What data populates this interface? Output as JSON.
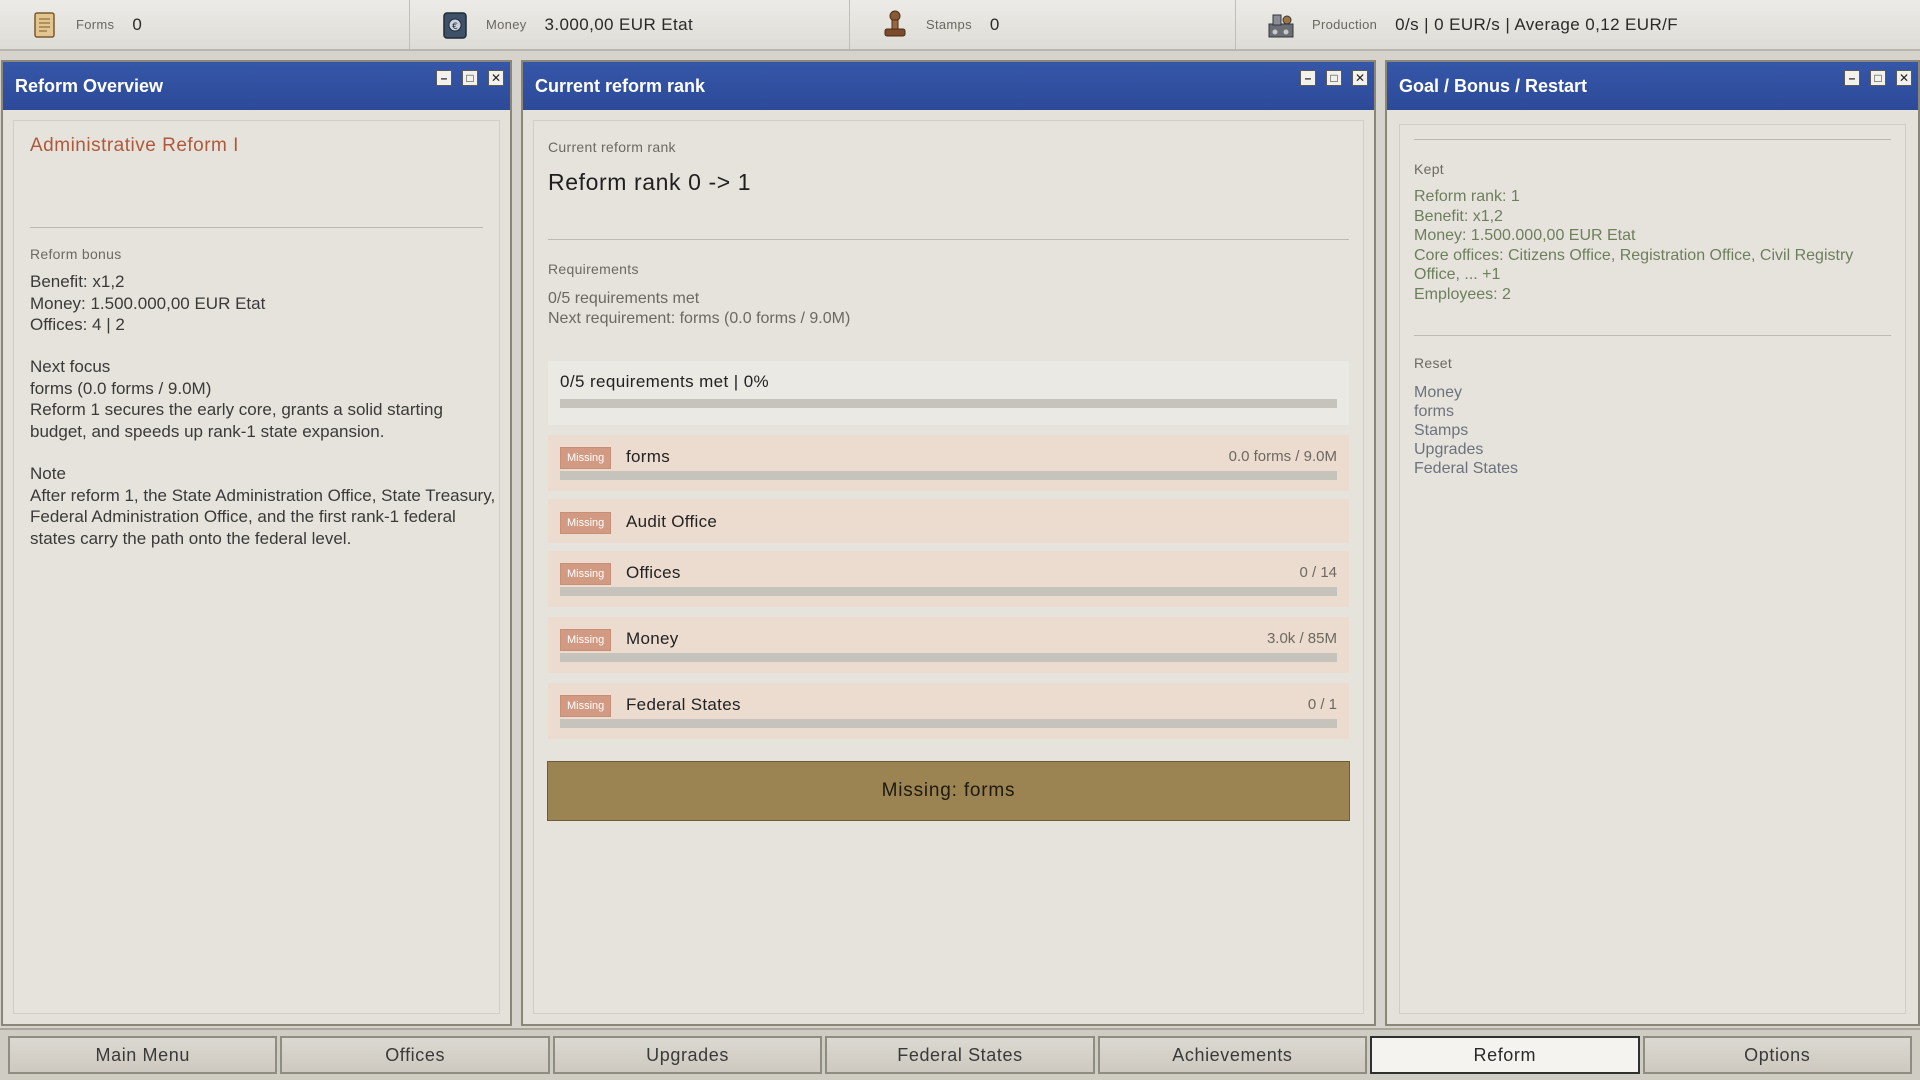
{
  "resources": {
    "forms": {
      "label": "Forms",
      "value": "0",
      "icon": "scroll-icon"
    },
    "money": {
      "label": "Money",
      "value": "3.000,00 EUR Etat",
      "icon": "money-book-icon"
    },
    "stamps": {
      "label": "Stamps",
      "value": "0",
      "icon": "stamp-icon"
    },
    "production": {
      "label": "Production",
      "value": "0/s | 0 EUR/s | Average 0,12 EUR/F",
      "icon": "machine-icon"
    }
  },
  "left_panel": {
    "title": "Reform Overview",
    "reform_name": "Administrative Reform I",
    "bonus_label": "Reform bonus",
    "bonus_lines": [
      "Benefit: x1,2",
      "Money: 1.500.000,00 EUR Etat",
      "Offices: 4 | 2"
    ],
    "focus_heading": "Next focus",
    "focus_lines": [
      "forms (0.0 forms / 9.0M)",
      "Reform 1 secures the early core, grants a solid starting budget, and speeds up rank-1 state expansion."
    ],
    "note_heading": "Note",
    "note_text": "After reform 1, the State Administration Office, State Treasury, Federal Administration Office, and the first rank-1 federal states carry the path onto the federal level."
  },
  "mid_panel": {
    "title": "Current reform rank",
    "rank_label": "Current reform rank",
    "rank_value": "Reform rank 0 -> 1",
    "req_label": "Requirements",
    "req_met": "0/5 requirements met",
    "next_req": "Next requirement: forms (0.0 forms / 9.0M)",
    "summary": "0/5 requirements met | 0%",
    "summary_progress": 0,
    "requirements": [
      {
        "status": "Missing",
        "name": "forms",
        "amount": "0.0 forms / 9.0M",
        "progress": 0
      },
      {
        "status": "Missing",
        "name": "Audit Office",
        "amount": ""
      },
      {
        "status": "Missing",
        "name": "Offices",
        "amount": "0 / 14",
        "progress": 0
      },
      {
        "status": "Missing",
        "name": "Money",
        "amount": "3.0k / 85M",
        "progress": 0
      },
      {
        "status": "Missing",
        "name": "Federal States",
        "amount": "0 / 1",
        "progress": 0
      }
    ],
    "action_button": "Missing: forms"
  },
  "right_panel": {
    "title": "Goal / Bonus / Restart",
    "kept_label": "Kept",
    "kept_lines": [
      "Reform rank: 1",
      "Benefit: x1,2",
      "Money: 1.500.000,00 EUR Etat",
      "Core offices: Citizens Office, Registration Office, Civil Registry Office, ... +1",
      "Employees: 2"
    ],
    "reset_label": "Reset",
    "reset_lines": [
      "Money",
      "forms",
      "Stamps",
      "Upgrades",
      "Federal States"
    ]
  },
  "window_buttons": {
    "minimize": "–",
    "maximize": "□",
    "close": "✕"
  },
  "nav": {
    "tabs": [
      "Main Menu",
      "Offices",
      "Upgrades",
      "Federal States",
      "Achievements",
      "Reform",
      "Options"
    ],
    "active": "Reform"
  },
  "colors": {
    "title_bar": "#2f4f9f",
    "reform_title": "#b0593a",
    "missing_badge": "#d29a83",
    "action_button": "#9b8352",
    "kept_text": "#6d7f5c"
  }
}
